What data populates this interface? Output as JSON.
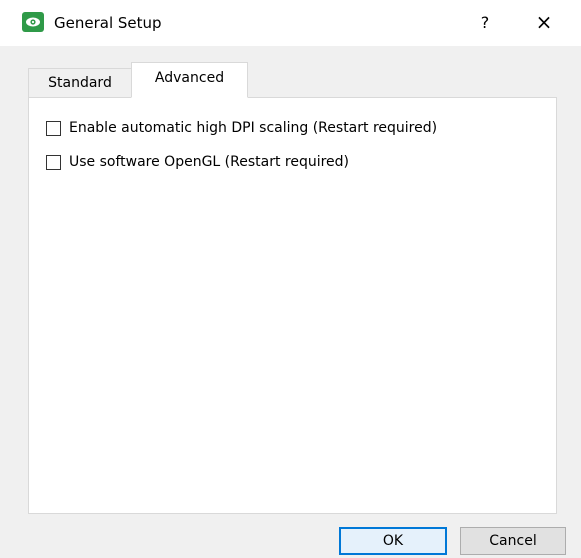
{
  "window": {
    "title": "General Setup",
    "icon": "eye-app-icon",
    "help_label": "?",
    "close_label": "×"
  },
  "tabs": [
    {
      "label": "Standard",
      "active": false
    },
    {
      "label": "Advanced",
      "active": true
    }
  ],
  "advanced": {
    "options": [
      {
        "label": "Enable automatic high DPI scaling (Restart required)",
        "checked": false
      },
      {
        "label": "Use software OpenGL (Restart required)",
        "checked": false
      }
    ]
  },
  "buttons": {
    "ok_label": "OK",
    "cancel_label": "Cancel"
  },
  "colors": {
    "app_icon": "#2f9a48",
    "default_button_border": "#0078d7"
  }
}
